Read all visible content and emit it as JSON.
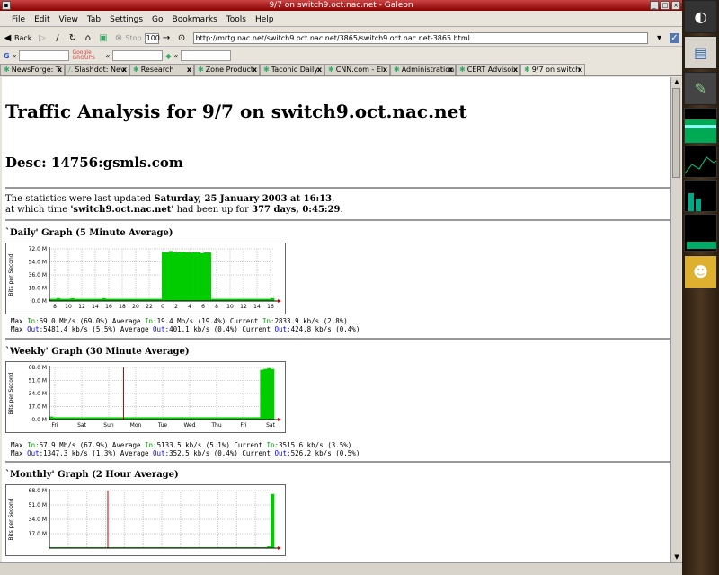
{
  "window": {
    "title": "9/7 on switch9.oct.nac.net - Galeon"
  },
  "menu": [
    "File",
    "Edit",
    "View",
    "Tab",
    "Settings",
    "Go",
    "Bookmarks",
    "Tools",
    "Help"
  ],
  "toolbar": {
    "back": "Back",
    "stop": "Stop",
    "zoom": "100",
    "url": "http://mrtg.nac.net/switch9.oct.nac.net/3865/switch9.oct.nac.net-3865.html"
  },
  "search": {
    "g_label": "G",
    "groups_label": "Google GROUPS"
  },
  "tabs": [
    {
      "label": "NewsForge: T"
    },
    {
      "label": "Slashdot: Nev"
    },
    {
      "label": "Research"
    },
    {
      "label": "Zone Product"
    },
    {
      "label": "Taconic Daily"
    },
    {
      "label": "CNN.com - El"
    },
    {
      "label": "Administration"
    },
    {
      "label": "CERT Advisoi"
    },
    {
      "label": "9/7 on switch:"
    }
  ],
  "page": {
    "title": "Traffic Analysis for 9/7 on switch9.oct.nac.net",
    "desc": "Desc: 14756:gsmls.com",
    "updated_pre": "The statistics were last updated ",
    "updated_date": "Saturday, 25 January 2003 at 16:13",
    "updated_mid": ",",
    "uptime_pre": "at which time ",
    "host": "'switch9.oct.nac.net'",
    "uptime_mid": " had been up for ",
    "uptime": "377 days, 0:45:29",
    "uptime_end": "."
  },
  "graphs": [
    {
      "title": "`Daily' Graph (5 Minute Average)",
      "legend1": {
        "max": "Max  ",
        "in_lbl": "In:",
        "max_in": "69.0 Mb/s (69.0%)",
        "avg": "  Average  ",
        "avg_in": "19.4 Mb/s (19.4%)",
        "cur": "  Current  ",
        "cur_in": "2833.9 kb/s (2.8%)"
      },
      "legend2": {
        "max": "Max ",
        "out_lbl": "Out:",
        "max_out": "5481.4 kb/s (5.5%)",
        "avg": "  Average  ",
        "avg_out": "401.1 kb/s (0.4%)",
        "cur": "  Current  ",
        "cur_out": "424.8 kb/s (0.4%)"
      }
    },
    {
      "title": "`Weekly' Graph (30 Minute Average)",
      "legend1": {
        "max": "Max  ",
        "in_lbl": "In:",
        "max_in": "67.9 Mb/s (67.9%)",
        "avg": "  Average  ",
        "avg_in": "5133.5 kb/s (5.1%)",
        "cur": "  Current  ",
        "cur_in": "3515.6 kb/s (3.5%)"
      },
      "legend2": {
        "max": "Max ",
        "out_lbl": "Out:",
        "max_out": "1347.3 kb/s (1.3%)",
        "avg": "  Average  ",
        "avg_out": "352.5 kb/s (0.4%)",
        "cur": "  Current  ",
        "cur_out": "526.2 kb/s (0.5%)"
      }
    },
    {
      "title": "`Monthly' Graph (2 Hour Average)"
    }
  ],
  "chart_data": [
    {
      "type": "area",
      "title": "",
      "ylabel": "Bits per Second",
      "yticks": [
        "0.0 M",
        "18.0 M",
        "36.0 M",
        "54.0 M",
        "72.0 M"
      ],
      "ylim": [
        0,
        72
      ],
      "xticks": [
        "8",
        "10",
        "12",
        "14",
        "16",
        "18",
        "20",
        "22",
        "0",
        "2",
        "4",
        "6",
        "8",
        "10",
        "12",
        "14",
        "16"
      ],
      "series": [
        {
          "name": "In",
          "color": "#00cc00",
          "values": [
            3,
            3,
            4,
            3,
            3,
            3,
            4,
            3,
            3,
            3,
            3,
            3,
            3,
            3,
            3,
            4,
            3,
            3,
            3,
            3,
            3,
            3,
            3,
            3,
            3,
            3,
            3,
            3,
            3,
            3,
            3,
            3,
            68,
            67,
            69,
            68,
            67,
            68,
            68,
            67,
            67,
            68,
            67,
            66,
            67,
            67,
            3,
            3,
            3,
            3,
            3,
            3,
            3,
            3,
            3,
            3,
            3,
            3,
            3,
            3,
            3,
            3,
            3,
            4
          ]
        }
      ]
    },
    {
      "type": "area",
      "title": "",
      "ylabel": "Bits per Second",
      "yticks": [
        "0.0 M",
        "17.0 M",
        "34.0 M",
        "51.0 M",
        "68.0 M"
      ],
      "ylim": [
        0,
        68
      ],
      "xticks": [
        "Fri",
        "Sat",
        "Sun",
        "Mon",
        "Tue",
        "Wed",
        "Thu",
        "Fri",
        "Sat"
      ],
      "series": [
        {
          "name": "In",
          "color": "#00cc00",
          "values": [
            4,
            3,
            3,
            3,
            3,
            3,
            3,
            3,
            3,
            3,
            3,
            3,
            3,
            3,
            3,
            3,
            3,
            3,
            3,
            3,
            3,
            3,
            3,
            3,
            3,
            3,
            3,
            3,
            3,
            3,
            3,
            3,
            3,
            3,
            3,
            3,
            3,
            3,
            3,
            3,
            3,
            3,
            3,
            3,
            3,
            3,
            3,
            3,
            3,
            3,
            3,
            3,
            3,
            3,
            3,
            3,
            3,
            3,
            3,
            3,
            65,
            66,
            67,
            66
          ]
        }
      ]
    },
    {
      "type": "area",
      "title": "",
      "ylabel": "Bits per Second",
      "yticks": [
        "17.0 M",
        "34.0 M",
        "51.0 M",
        "68.0 M"
      ],
      "ylim": [
        0,
        68
      ],
      "xticks": [],
      "series": [
        {
          "name": "In",
          "color": "#00cc00",
          "values": [
            1,
            1,
            1,
            1,
            1,
            1,
            1,
            1,
            1,
            1,
            1,
            1,
            1,
            1,
            1,
            1,
            1,
            1,
            1,
            1,
            1,
            1,
            1,
            1,
            1,
            1,
            1,
            1,
            1,
            1,
            1,
            1,
            1,
            1,
            1,
            1,
            1,
            1,
            1,
            1,
            1,
            1,
            1,
            1,
            1,
            1,
            1,
            1,
            1,
            1,
            1,
            1,
            1,
            1,
            1,
            1,
            1,
            1,
            1,
            1,
            1,
            2,
            64
          ]
        }
      ]
    }
  ]
}
